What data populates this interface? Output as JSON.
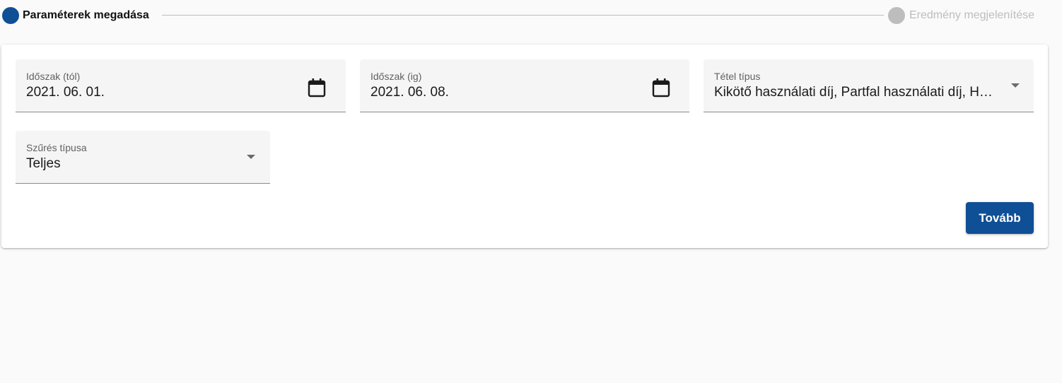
{
  "stepper": {
    "steps": [
      {
        "label": "Paraméterek megadása",
        "state": "active"
      },
      {
        "label": "Eredmény megjelenítése",
        "state": "inactive"
      }
    ],
    "active_color": "#0f4f96",
    "inactive_color": "#bdbdbd"
  },
  "form": {
    "date_from": {
      "label": "Időszak (tól)",
      "value": "2021. 06. 01.",
      "icon": "calendar-icon"
    },
    "date_to": {
      "label": "Időszak (ig)",
      "value": "2021. 06. 08.",
      "icon": "calendar-icon"
    },
    "item_type": {
      "label": "Tétel típus",
      "value": "Kikötő használati díj, Partfal használati díj, H…",
      "icon": "dropdown-arrow-icon"
    },
    "filter_type": {
      "label": "Szűrés típusa",
      "value": "Teljes",
      "icon": "dropdown-arrow-icon"
    }
  },
  "actions": {
    "next_label": "Tovább",
    "next_color": "#0f4f96"
  }
}
